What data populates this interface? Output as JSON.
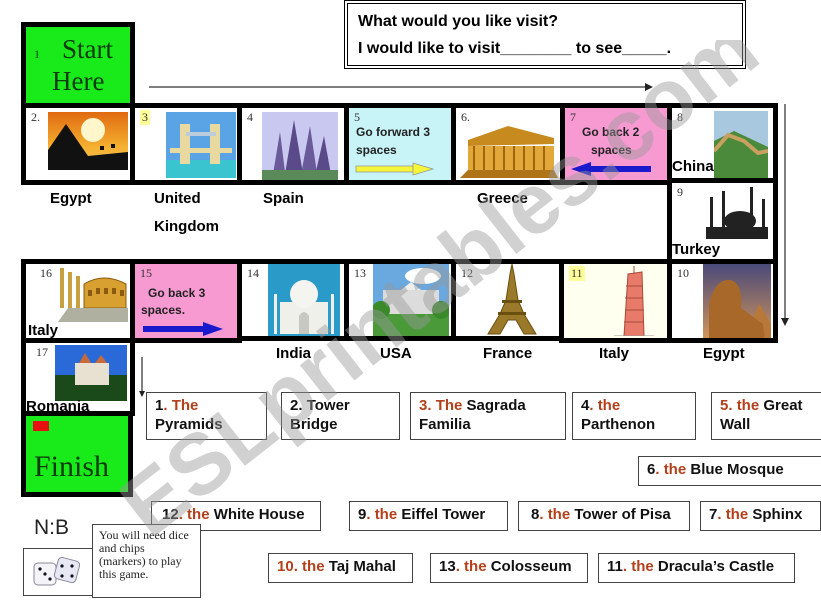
{
  "question": {
    "line1": "What would you like visit?",
    "line2": "I would like to visit________ to see_____."
  },
  "board": {
    "start": {
      "number": "1",
      "label_line1": "Start",
      "label_line2": "Here"
    },
    "finish": {
      "label": "Finish"
    },
    "squares": [
      {
        "number": "2.",
        "country": "Egypt",
        "image": "pyramids-sunset-image"
      },
      {
        "number": "3",
        "country": "United Kingdom",
        "country_line1": "United",
        "country_line2": "Kingdom",
        "image": "tower-bridge-image"
      },
      {
        "number": "4",
        "country": "Spain",
        "image": "sagrada-familia-image"
      },
      {
        "number": "5",
        "action_line1": "Go forward 3",
        "action_line2": "spaces",
        "color": "#c8f4f8",
        "arrow": "right",
        "arrow_color": "#f5f53a"
      },
      {
        "number": "6.",
        "country": "Greece",
        "image": "parthenon-image"
      },
      {
        "number": "7",
        "action_line1": "Go back 2",
        "action_line2": "spaces",
        "color": "#f79ad2",
        "arrow": "left",
        "arrow_color": "#1a1acc"
      },
      {
        "number": "8",
        "country": "China",
        "image": "great-wall-image"
      },
      {
        "number": "9",
        "country": "Turkey",
        "image": "blue-mosque-image"
      },
      {
        "number": "10",
        "country": "Egypt",
        "image": "sphinx-image"
      },
      {
        "number": "11",
        "country": "Italy",
        "image": "tower-of-pisa-image"
      },
      {
        "number": "12",
        "country": "France",
        "image": "eiffel-tower-image"
      },
      {
        "number": "13",
        "country": "USA",
        "image": "white-house-image"
      },
      {
        "number": "14",
        "country": "India",
        "image": "taj-mahal-image"
      },
      {
        "number": "15",
        "action_line1": "Go back 3",
        "action_line2": "spaces.",
        "color": "#f79ad2",
        "arrow": "right",
        "arrow_color": "#1a1acc"
      },
      {
        "number": "16",
        "country": "Italy",
        "image": "colosseum-image"
      },
      {
        "number": "17",
        "country": "Romania",
        "image": "draculas-castle-image"
      }
    ]
  },
  "answers": [
    {
      "num": "1",
      "article": "The",
      "name": "Pyramids"
    },
    {
      "num": "2",
      "article": "",
      "name": "Tower Bridge",
      "name_line1": "Tower",
      "name_line2": "Bridge"
    },
    {
      "num": "3",
      "article": "The",
      "name": "Sagrada Familia",
      "name_line1": "Sagrada",
      "name_line2": "Familia"
    },
    {
      "num": "4",
      "article": "the",
      "name": "Parthenon"
    },
    {
      "num": "5",
      "article": "the",
      "name": "Great Wall",
      "name_line1": "Great",
      "name_line2": "Wall"
    },
    {
      "num": "6",
      "article": "the",
      "name": "Blue Mosque"
    },
    {
      "num": "12",
      "article": "the",
      "name": "White House"
    },
    {
      "num": "9",
      "article": "the",
      "name": "Eiffel Tower"
    },
    {
      "num": "8",
      "article": "the",
      "name": "Tower of Pisa"
    },
    {
      "num": "7",
      "article": "the",
      "name": "Sphinx"
    },
    {
      "num": "10",
      "article": "the",
      "name": "Taj Mahal"
    },
    {
      "num": "13",
      "article": "the",
      "name": "Colosseum"
    },
    {
      "num": "11",
      "article": "the",
      "name": "Dracula’s Castle"
    }
  ],
  "note": {
    "label": "N:B",
    "text": "You will need dice and chips (markers) to play this game.",
    "icon": "dice-icon"
  },
  "watermark": "ESLprintables.com",
  "colors": {
    "start_finish": "#19ea1a",
    "go_forward": "#c8f4f8",
    "go_back": "#f79ad2",
    "article_red": "#b3401a"
  }
}
